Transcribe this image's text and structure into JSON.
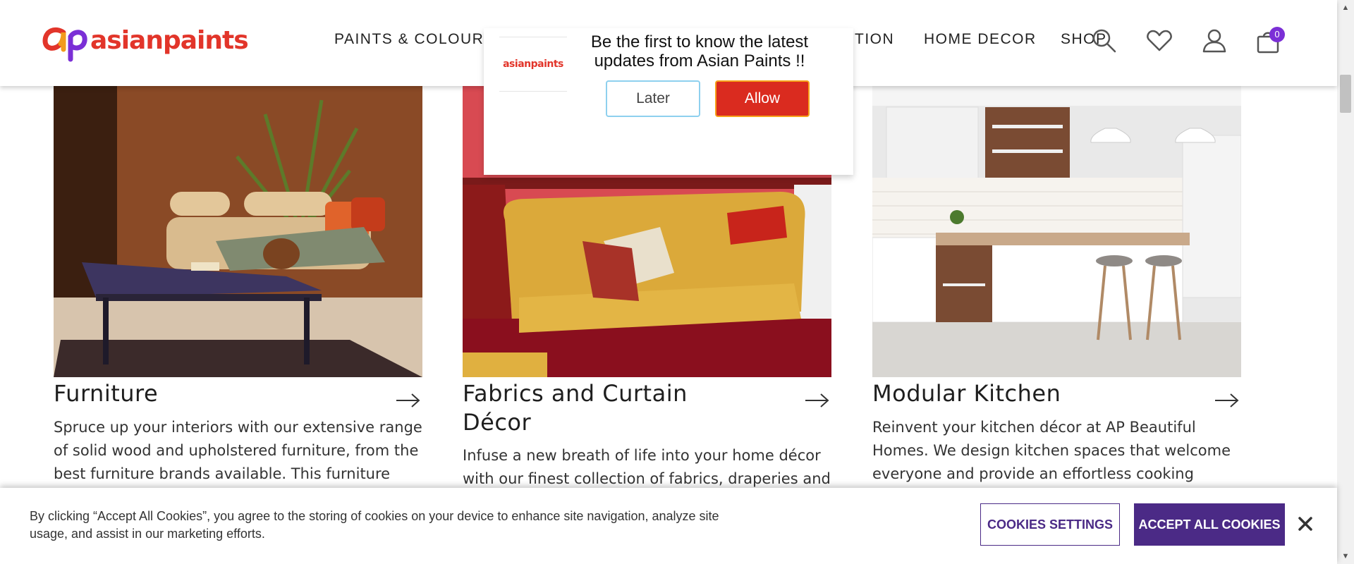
{
  "header": {
    "logo_text": "asianpaints",
    "nav": [
      {
        "label": "PAINTS & COLOURS"
      },
      {
        "label": "TION"
      },
      {
        "label": "HOME DECOR"
      },
      {
        "label": "SHOP"
      }
    ],
    "icons": [
      "search-icon",
      "wishlist-icon",
      "user-icon",
      "cart-icon"
    ],
    "cart_count": "0"
  },
  "notification": {
    "logo_text": "asianpaints",
    "message": "Be the first to know the latest updates from Asian Paints !!",
    "later_label": "Later",
    "allow_label": "Allow"
  },
  "cards": [
    {
      "title": "Furniture",
      "description": "Spruce up your interiors with our extensive range of solid wood and upholstered furniture, from the best furniture brands available. This furniture"
    },
    {
      "title": "Fabrics and Curtain Décor",
      "description": "Infuse a new breath of life into your home décor with our finest collection of fabrics, draperies and"
    },
    {
      "title": "Modular Kitchen",
      "description": "Reinvent your kitchen décor at AP Beautiful Homes. We design kitchen spaces that welcome everyone and provide an effortless cooking"
    }
  ],
  "cookie_bar": {
    "text": "By clicking “Accept All Cookies”, you agree to the storing of cookies on your device to enhance site navigation, analyze site usage, and assist in our marketing efforts.",
    "settings_label": "COOKIES SETTINGS",
    "accept_label": "ACCEPT ALL COOKIES"
  },
  "colors": {
    "brand_red": "#e2352a",
    "allow_red": "#da2b1f",
    "cookie_purple": "#4b2a86",
    "badge_purple": "#7b2fd6"
  }
}
